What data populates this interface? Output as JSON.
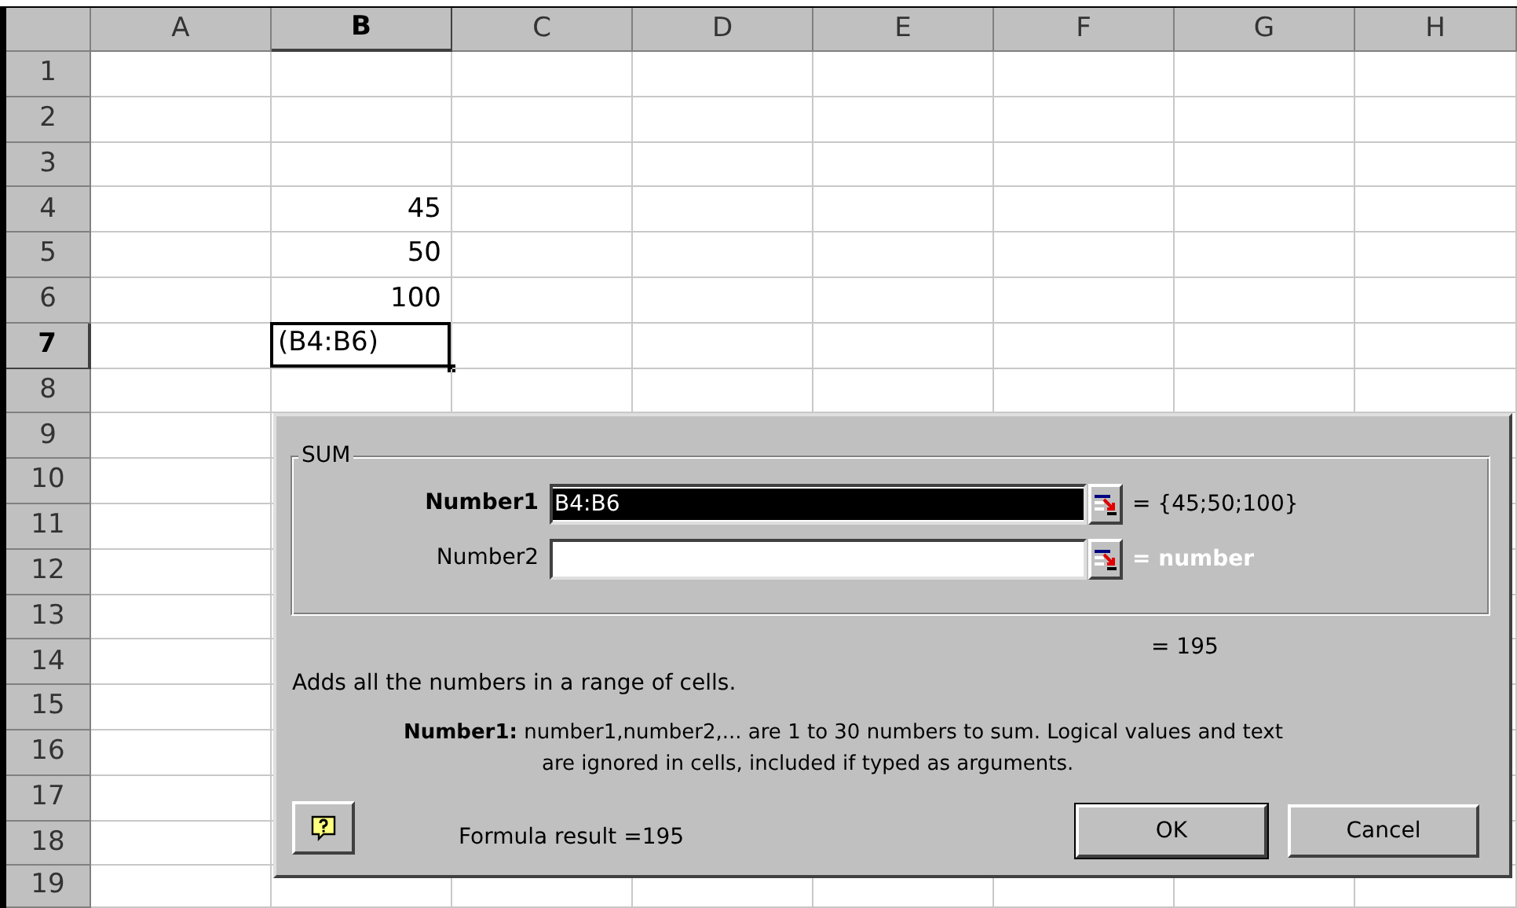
{
  "columns": [
    {
      "label": "A",
      "selected": false
    },
    {
      "label": "B",
      "selected": true
    },
    {
      "label": "C",
      "selected": false
    },
    {
      "label": "D",
      "selected": false
    },
    {
      "label": "E",
      "selected": false
    },
    {
      "label": "F",
      "selected": false
    },
    {
      "label": "G",
      "selected": false
    },
    {
      "label": "H",
      "selected": false
    }
  ],
  "rows": [
    {
      "label": "1",
      "selected": false
    },
    {
      "label": "2",
      "selected": false
    },
    {
      "label": "3",
      "selected": false
    },
    {
      "label": "4",
      "selected": false,
      "column_b": {
        "kind": "number",
        "value": "45",
        "selected": false
      }
    },
    {
      "label": "5",
      "selected": false,
      "column_b": {
        "kind": "number",
        "value": "50",
        "selected": false
      }
    },
    {
      "label": "6",
      "selected": false,
      "column_b": {
        "kind": "number",
        "value": "100",
        "selected": false
      }
    },
    {
      "label": "7",
      "selected": true,
      "column_b": {
        "kind": "text",
        "value": "(B4:B6)",
        "selected": true
      }
    },
    {
      "label": "8",
      "selected": false
    },
    {
      "label": "9",
      "selected": false
    },
    {
      "label": "10",
      "selected": false
    },
    {
      "label": "11",
      "selected": false
    },
    {
      "label": "12",
      "selected": false
    },
    {
      "label": "13",
      "selected": false
    },
    {
      "label": "14",
      "selected": false
    },
    {
      "label": "15",
      "selected": false
    },
    {
      "label": "16",
      "selected": false
    },
    {
      "label": "17",
      "selected": false
    },
    {
      "label": "18",
      "selected": false
    },
    {
      "label": "19",
      "selected": false
    }
  ],
  "dialog": {
    "group_title": "SUM",
    "arguments": [
      {
        "label": "Number1",
        "active": true,
        "value": "B4:B6",
        "result": "= {45;50;100}",
        "result_is_hint": false
      },
      {
        "label": "Number2",
        "active": false,
        "result": "= number",
        "result_is_hint": true
      }
    ],
    "formula_value": "= 195",
    "description": "Adds all the numbers in a range of cells.",
    "argument_help": "**Number1:** number1,number2,... are 1 to 30 numbers to sum. Logical values and text are ignored in cells, included if typed as arguments.",
    "formula_result": "Formula result =195",
    "buttons": [
      "OK",
      "Cancel"
    ]
  }
}
